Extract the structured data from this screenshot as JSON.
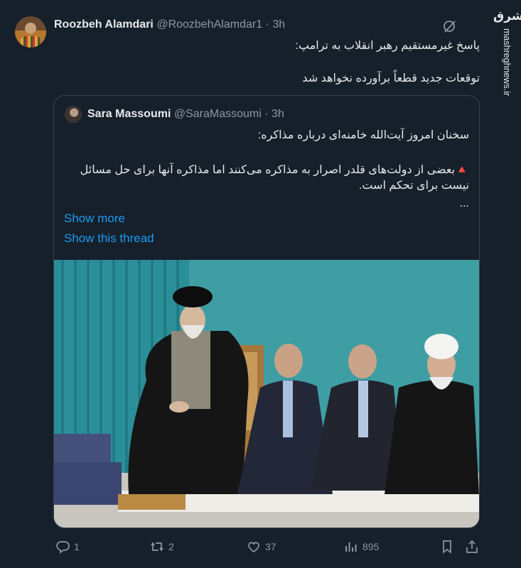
{
  "tweet": {
    "author_name": "Roozbeh Alamdari",
    "handle_time": "@RoozbehAlamdar1 · 3h",
    "line1": "پاسخ غیرمستقیم رهبر انقلاب به ترامپ:",
    "line2": "توقعات جدید قطعاً برآورده نخواهد شد"
  },
  "watermark": {
    "logo": "مشرق",
    "site": "mashreghnews.ir"
  },
  "quote": {
    "author_name": "Sara Massoumi",
    "handle_time": "@SaraMassoumi · 3h",
    "line1": "سخنان امروز آیت‌الله خامنه‌ای درباره مذاکره:",
    "line2_marker": "🔺",
    "line2": "بعضی از دولت‌های قلدر اصرار به مذاکره می‌کنند اما مذاکره آنها برای حل مسائل نیست برای تحکم است.",
    "line3": "...",
    "show_more": "Show more",
    "show_thread": "Show this thread"
  },
  "actions": {
    "replies": "1",
    "retweets": "2",
    "likes": "37",
    "views": "895"
  },
  "colors": {
    "background": "#15202b",
    "text": "#e7e9ea",
    "muted": "#8b98a5",
    "link": "#1d9bf0",
    "border": "#38444d"
  },
  "icons": [
    "grok-icon",
    "reply-icon",
    "retweet-icon",
    "like-icon",
    "views-icon",
    "bookmark-icon",
    "share-icon"
  ]
}
